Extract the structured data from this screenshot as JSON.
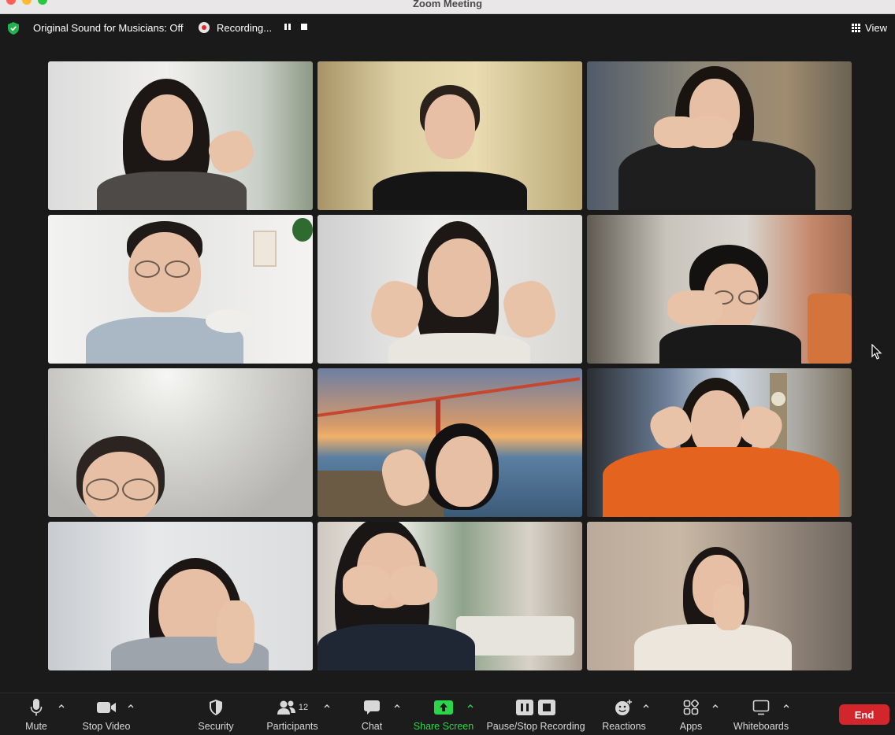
{
  "window": {
    "title": "Zoom Meeting"
  },
  "infobar": {
    "original_sound": "Original Sound for Musicians: Off",
    "recording": "Recording...",
    "view_label": "View"
  },
  "toolbar": {
    "mute": "Mute",
    "stop_video": "Stop Video",
    "security": "Security",
    "participants": "Participants",
    "participants_count": "12",
    "chat": "Chat",
    "share_screen": "Share Screen",
    "pause_stop_recording": "Pause/Stop Recording",
    "reactions": "Reactions",
    "apps": "Apps",
    "whiteboards": "Whiteboards",
    "end": "End"
  },
  "colors": {
    "active_speaker_border": "#38d648",
    "share_screen_green": "#2bd54a",
    "end_red": "#d2262c",
    "recording_red": "#e02828"
  }
}
